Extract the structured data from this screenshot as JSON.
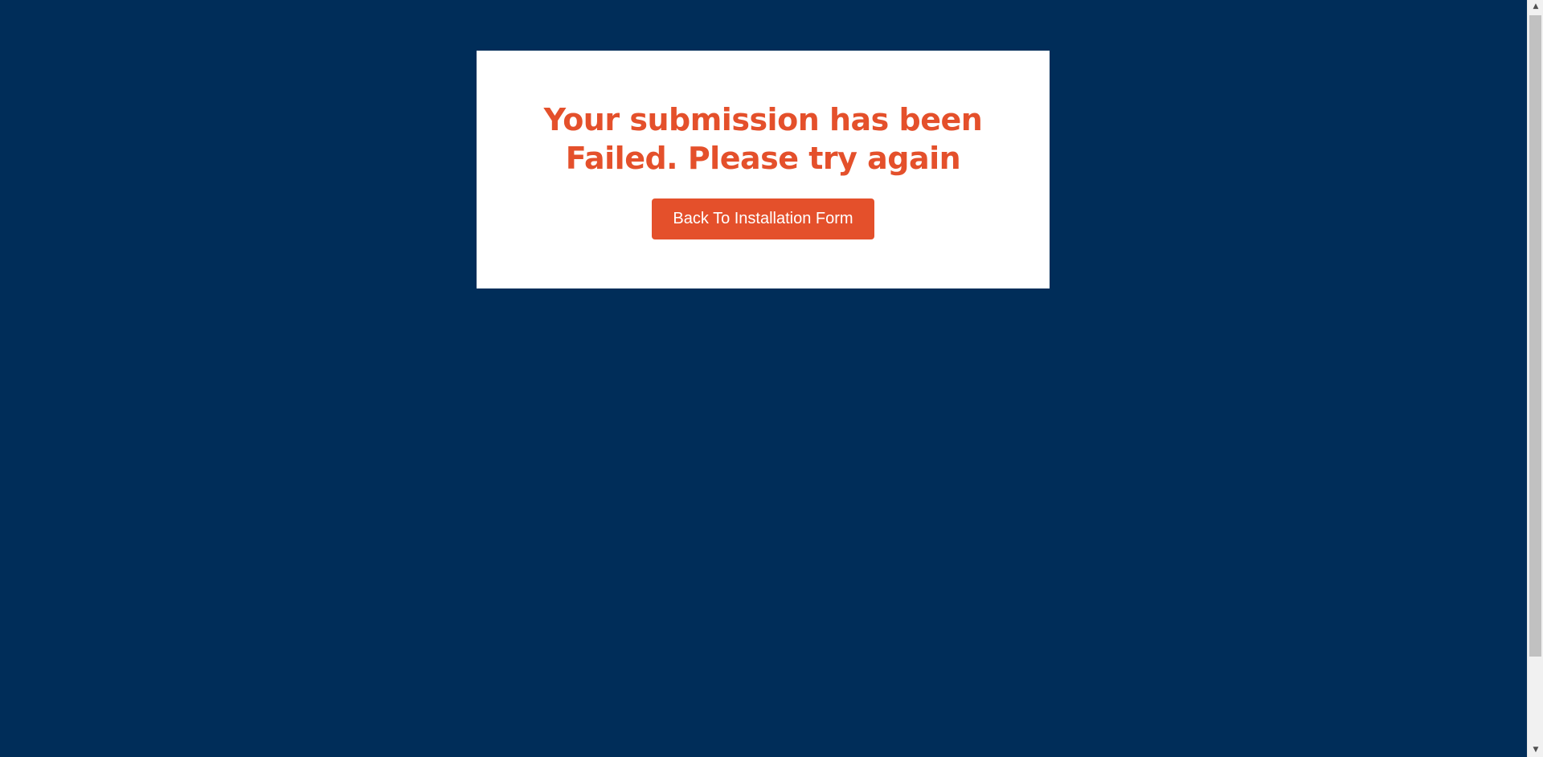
{
  "message": {
    "headline_line1": "Your submission has been",
    "headline_line2": "Failed. Please try again"
  },
  "actions": {
    "back_label": "Back To Installation Form"
  },
  "scrollbar": {
    "up_icon": "▲",
    "down_icon": "▼"
  },
  "colors": {
    "background": "#002d59",
    "accent": "#e4502b",
    "card": "#ffffff"
  }
}
